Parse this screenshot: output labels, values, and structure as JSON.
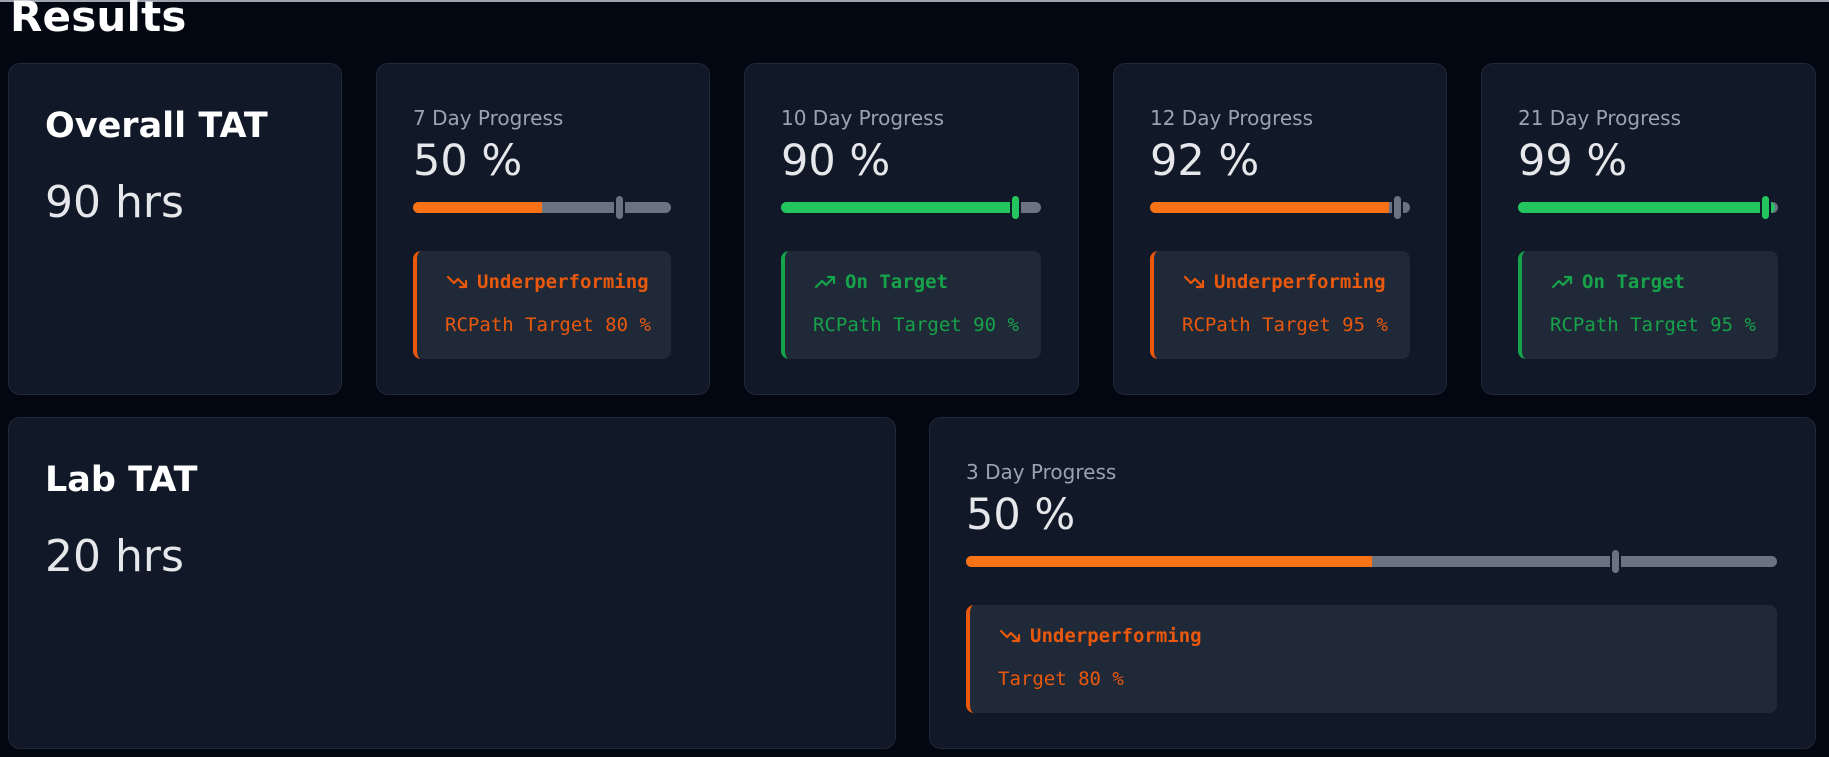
{
  "page": {
    "title": "Results"
  },
  "overall": {
    "title": "Overall TAT",
    "value": "90 hrs",
    "progress": [
      {
        "label": "7 Day Progress",
        "value": "50 %",
        "fill_pct": 50,
        "target_pct": 80,
        "status": "Underperforming",
        "target_text": "RCPath Target 80 %",
        "state": "bad"
      },
      {
        "label": "10 Day Progress",
        "value": "90 %",
        "fill_pct": 90,
        "target_pct": 90,
        "status": "On Target",
        "target_text": "RCPath Target 90 %",
        "state": "good"
      },
      {
        "label": "12 Day Progress",
        "value": "92 %",
        "fill_pct": 92,
        "target_pct": 95,
        "status": "Underperforming",
        "target_text": "RCPath Target 95 %",
        "state": "bad"
      },
      {
        "label": "21 Day Progress",
        "value": "99 %",
        "fill_pct": 99,
        "target_pct": 95,
        "status": "On Target",
        "target_text": "RCPath Target 95 %",
        "state": "good"
      }
    ]
  },
  "lab": {
    "title": "Lab TAT",
    "value": "20 hrs",
    "progress": {
      "label": "3 Day Progress",
      "value": "50 %",
      "fill_pct": 50,
      "target_pct": 80,
      "status": "Underperforming",
      "target_text": "Target 80 %",
      "state": "bad"
    }
  },
  "colors": {
    "bad": "#ea580c",
    "bad_fill": "#f97316",
    "good": "#16a34a",
    "good_fill": "#22c55e",
    "track": "#6b7280"
  },
  "icons": {
    "bad": "trending-down-icon",
    "good": "trending-up-icon"
  }
}
